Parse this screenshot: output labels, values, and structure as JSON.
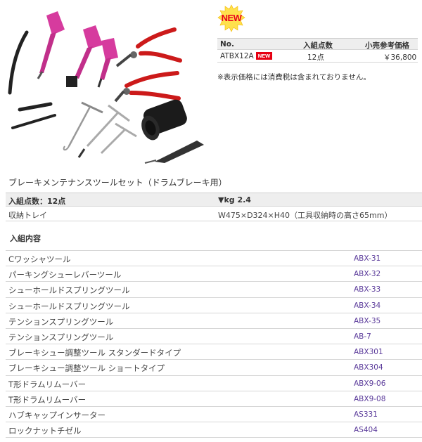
{
  "badge": {
    "new_label": "NEW",
    "color": "#e8001b"
  },
  "product_table": {
    "headers": {
      "no": "No.",
      "count": "入組点数",
      "price": "小売参考価格"
    },
    "row": {
      "no": "ATBX12A",
      "new_tag": "NEW",
      "count": "12点",
      "price": "￥36,800"
    }
  },
  "tax_note": "※表示価格には消費税は含まれておりません。",
  "set_title": "ブレーキメンテナンスツールセット（ドラムブレーキ用）",
  "spec": {
    "header_count": "入組点数：12点",
    "header_weight": "▼kg 2.4",
    "tray_label": "収納トレイ",
    "tray_dims": "W475×D324×H40（工具収納時の高さ65mm）"
  },
  "contents_title": "入組内容",
  "contents": [
    {
      "name": "Cワッシャツール",
      "code": "ABX-31"
    },
    {
      "name": "パーキングシューレバーツール",
      "code": "ABX-32"
    },
    {
      "name": "シューホールドスプリングツール",
      "code": "ABX-33"
    },
    {
      "name": "シューホールドスプリングツール",
      "code": "ABX-34"
    },
    {
      "name": "テンションスプリングツール",
      "code": "ABX-35"
    },
    {
      "name": "テンションスプリングツール",
      "code": "AB-7"
    },
    {
      "name": "ブレーキシュー調整ツール スタンダードタイプ",
      "code": "ABX301"
    },
    {
      "name": "ブレーキシュー調整ツール ショートタイプ",
      "code": "ABX304"
    },
    {
      "name": "T形ドラムリムーバー",
      "code": "ABX9-06"
    },
    {
      "name": "T形ドラムリムーバー",
      "code": "ABX9-08"
    },
    {
      "name": "ハブキャップインサーター",
      "code": "AS331"
    },
    {
      "name": "ロックナットチゼル",
      "code": "AS404"
    }
  ],
  "colors": {
    "link": "#5a3a9a",
    "handle": "#d63b9e",
    "header_bg": "#eeeeee"
  }
}
